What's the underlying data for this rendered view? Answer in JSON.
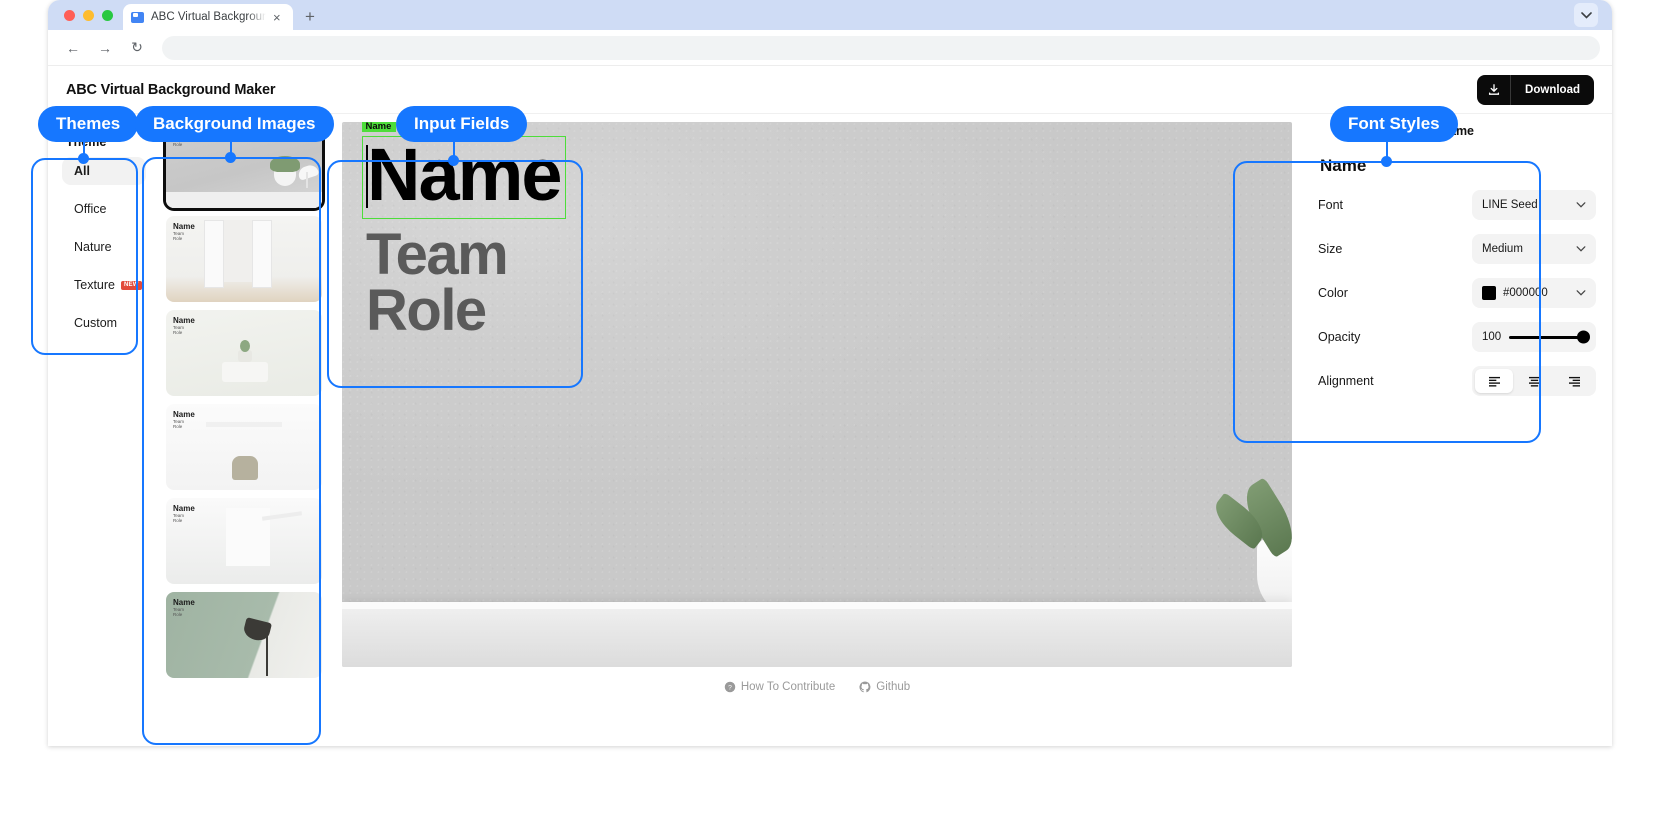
{
  "browser": {
    "tab_title": "ABC Virtual Background Maker",
    "new_tab_label": "+",
    "close_label": "×",
    "back_icon": "←",
    "forward_icon": "→",
    "reload_icon": "↻",
    "tabstrip_menu_icon": "chevron-down-icon",
    "address_value": ""
  },
  "app": {
    "title": "ABC Virtual Background Maker",
    "download_label": "Download"
  },
  "themes": {
    "section_title": "Select Theme",
    "items": [
      {
        "label": "All",
        "active": true,
        "badge": ""
      },
      {
        "label": "Office",
        "active": false,
        "badge": ""
      },
      {
        "label": "Nature",
        "active": false,
        "badge": ""
      },
      {
        "label": "Texture",
        "active": false,
        "badge": "NEW"
      },
      {
        "label": "Custom",
        "active": false,
        "badge": ""
      }
    ]
  },
  "thumbnails": {
    "overlay": {
      "name": "Name",
      "team": "Team",
      "role": "Role"
    },
    "items": [
      {
        "scene": "s1",
        "selected": true
      },
      {
        "scene": "s2",
        "selected": false
      },
      {
        "scene": "s3",
        "selected": false
      },
      {
        "scene": "s4",
        "selected": false
      },
      {
        "scene": "s5",
        "selected": false
      },
      {
        "scene": "s6",
        "selected": false
      }
    ]
  },
  "canvas": {
    "field_label": "Name",
    "name_value": "Name",
    "team_value": "Team",
    "role_value": "Role"
  },
  "font_styles": {
    "tab_label": "Name",
    "panel_title": "Name",
    "rows": {
      "font": {
        "label": "Font",
        "value": "LINE Seed"
      },
      "size": {
        "label": "Size",
        "value": "Medium"
      },
      "color": {
        "label": "Color",
        "value": "#000000",
        "swatch": "#000000"
      },
      "opacity": {
        "label": "Opacity",
        "value": "100"
      },
      "alignment": {
        "label": "Alignment",
        "selected": "left"
      }
    }
  },
  "footer": {
    "contribute": "How To Contribute",
    "github": "Github"
  },
  "annotations": {
    "themes": "Themes",
    "background_images": "Background Images",
    "input_fields": "Input Fields",
    "font_styles": "Font Styles"
  },
  "colors": {
    "accent_blue": "#1677ff",
    "selection_green": "#4ddd3a",
    "badge_red": "#e24b3c",
    "button_black": "#0b0b0b"
  }
}
